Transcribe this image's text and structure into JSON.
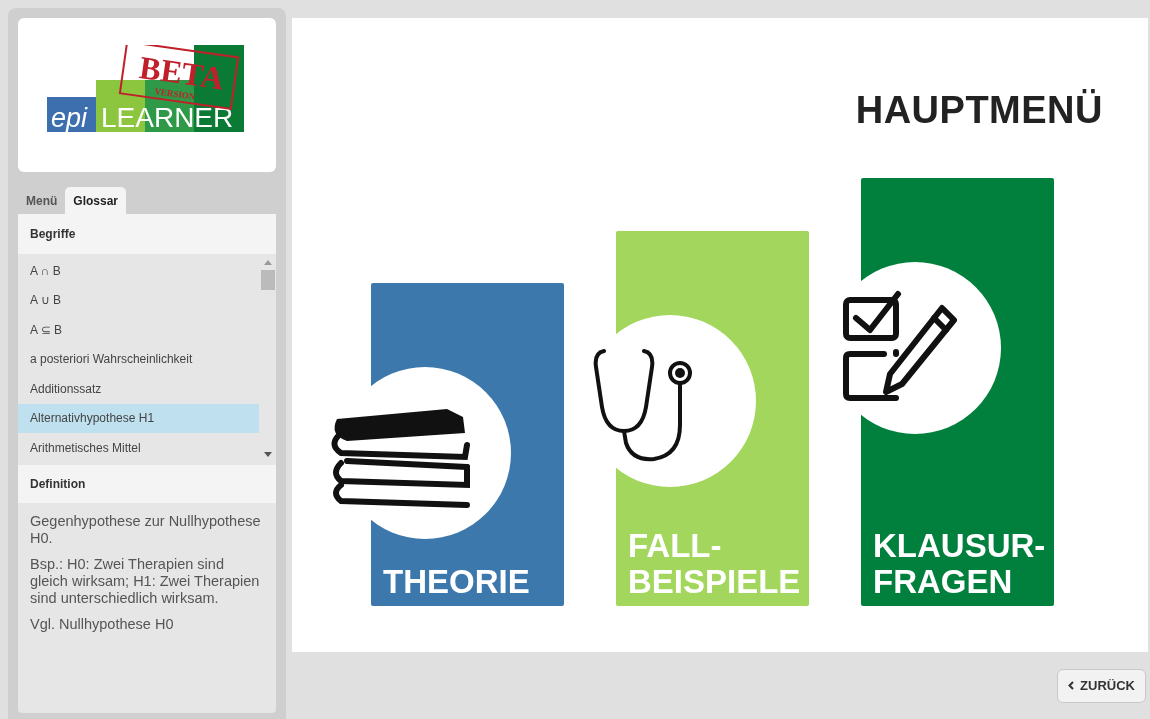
{
  "logo": {
    "prefix": "epi",
    "name": "LEARNER",
    "stamp": "BETA",
    "stamp_sub": "VERSION"
  },
  "sidebar": {
    "tabs": [
      {
        "label": "Menü",
        "selected": false
      },
      {
        "label": "Glossar",
        "selected": true
      }
    ],
    "terms_heading": "Begriffe",
    "terms": [
      {
        "label": "A ∩ B",
        "selected": false
      },
      {
        "label": "A ∪ B",
        "selected": false
      },
      {
        "label": "A ⊆ B",
        "selected": false
      },
      {
        "label": "a posteriori Wahrscheinlichkeit",
        "selected": false
      },
      {
        "label": "Additionssatz",
        "selected": false
      },
      {
        "label": "Alternativhypothese H1",
        "selected": true
      },
      {
        "label": "Arithmetisches Mittel",
        "selected": false
      }
    ],
    "definition_heading": "Definition",
    "definition": [
      "Gegenhypothese zur Nullhypothese H0.",
      "Bsp.: H0: Zwei Therapien sind gleich wirksam; H1: Zwei Therapien sind unterschiedlich wirksam.",
      "Vgl. Nullhypothese H0"
    ]
  },
  "main": {
    "title": "HAUPTMENÜ",
    "tiles": [
      {
        "kind": "books",
        "lines": [
          "THEORIE"
        ],
        "color": "#3d78ad"
      },
      {
        "kind": "stethoscope",
        "lines": [
          "FALL-",
          "BEISPIELE"
        ],
        "color": "#a3d65c"
      },
      {
        "kind": "exam",
        "lines": [
          "KLAUSUR-",
          "FRAGEN"
        ],
        "color": "#00803c"
      }
    ]
  },
  "back_button": {
    "label": "ZURÜCK"
  }
}
